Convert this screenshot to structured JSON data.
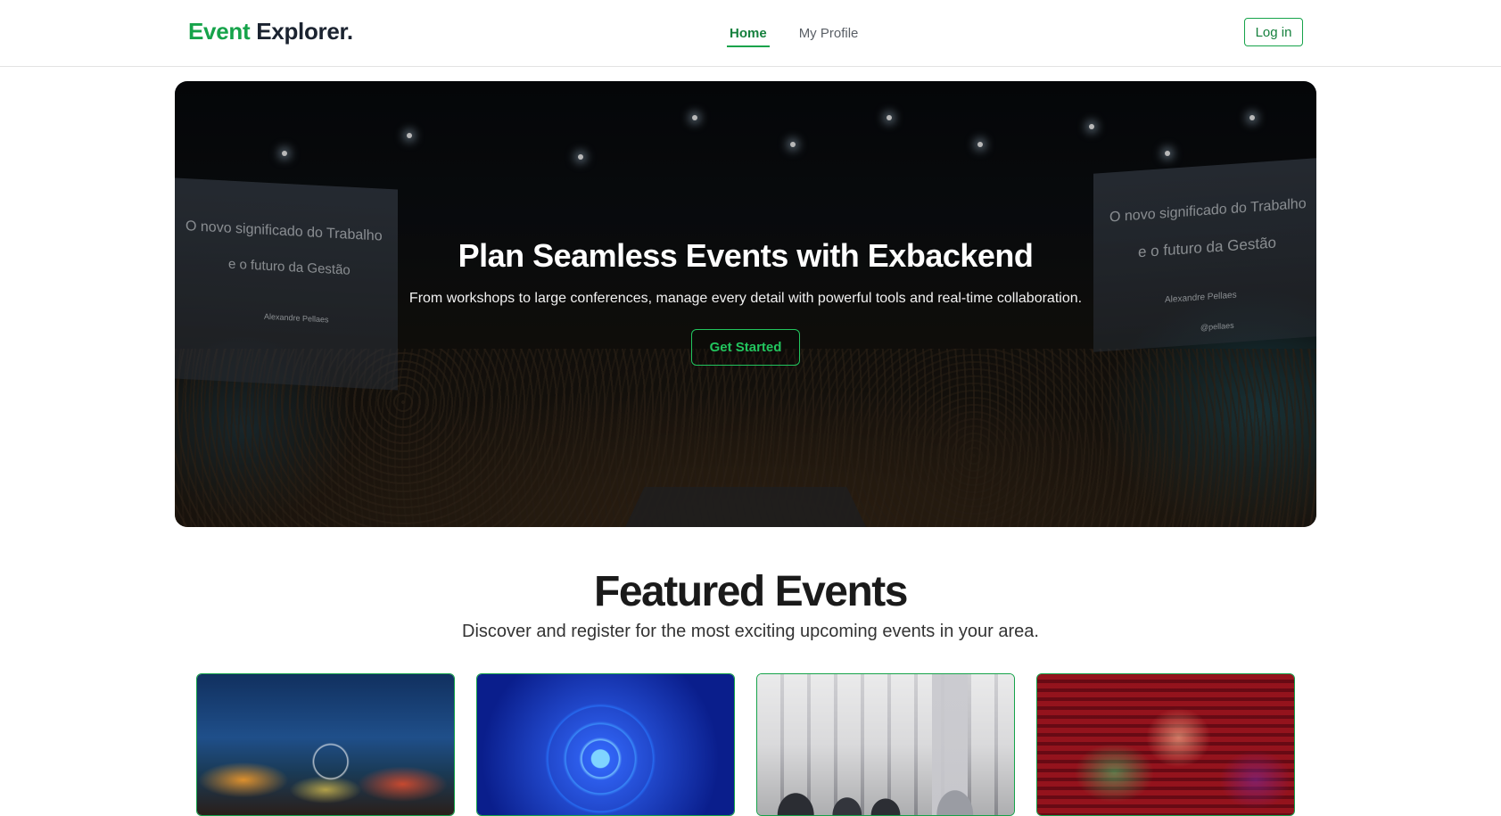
{
  "navbar": {
    "brand_primary": "Event",
    "brand_secondary": "Explorer.",
    "links": [
      {
        "label": "Home",
        "active": true
      },
      {
        "label": "My Profile",
        "active": false
      }
    ],
    "login_label": "Log in"
  },
  "hero": {
    "title": "Plan Seamless Events with Exbackend",
    "subtitle": "From workshops to large conferences, manage every detail with powerful tools and real-time collaboration.",
    "cta_label": "Get Started",
    "screen_left": {
      "line1": "O novo significado do Trabalho",
      "line2": "e o futuro da Gestão",
      "line3": "Alexandre Pellaes"
    },
    "screen_right": {
      "line1": "O novo significado do Trabalho",
      "line2": "e o futuro da Gestão",
      "line3": "Alexandre Pellaes",
      "line4": "@pellaes"
    }
  },
  "featured": {
    "title": "Featured Events",
    "subtitle": "Discover and register for the most exciting upcoming events in your area."
  },
  "colors": {
    "accent": "#16a34a",
    "brand_dark": "#1b2330",
    "cta": "#22c55e"
  }
}
